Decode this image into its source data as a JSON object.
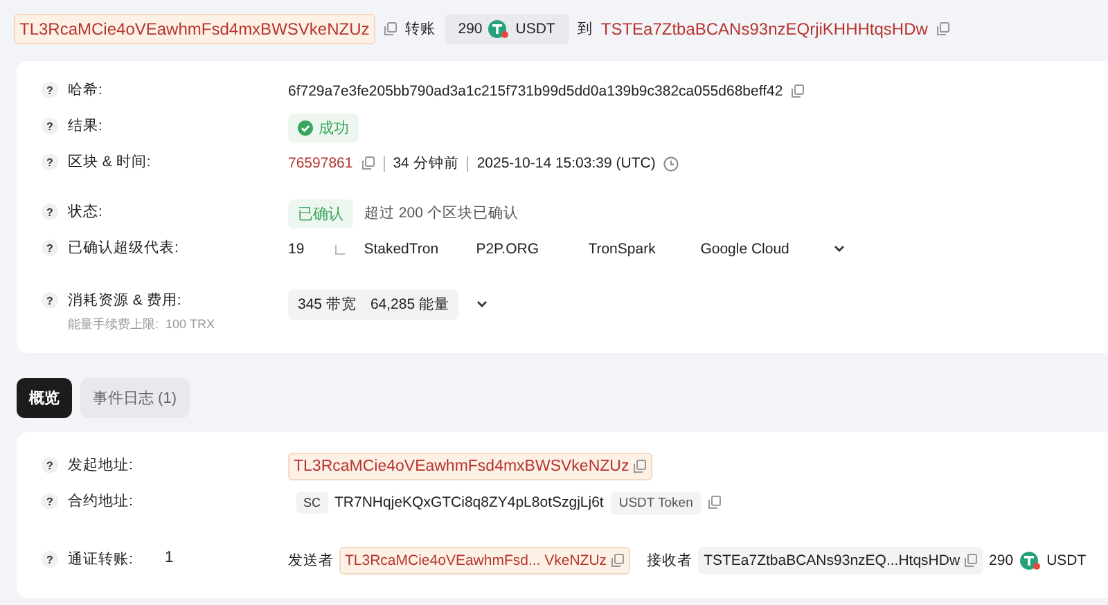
{
  "header": {
    "from": "TL3RcaMCie4oVEawhmFsd4mxBWSVkeNZUz",
    "action": "转账",
    "amount": "290",
    "token": "USDT",
    "to_word": "到",
    "to": "TSTEa7ZtbaBCANs93nzEQrjiKHHHtqsHDw"
  },
  "details": [
    {
      "kind": "hash",
      "help": "?",
      "label": "哈希:",
      "value": "6f729a7e3fe205bb790ad3a1c215f731b99d5dd0a139b9c382ca055d68beff42"
    },
    {
      "kind": "result",
      "help": "?",
      "label": "结果:",
      "badge": "成功"
    },
    {
      "kind": "block",
      "help": "?",
      "label": "区块 & 时间:",
      "block": "76597861",
      "ago": "34 分钟前",
      "time": "2025-10-14 15:03:39 (UTC)"
    },
    {
      "kind": "confirm",
      "help": "?",
      "label": "状态:",
      "badge": "已确认",
      "note": "超过 200 个区块已确认"
    },
    {
      "kind": "reps",
      "help": "?",
      "label": "已确认超级代表:",
      "count": "19",
      "reps": [
        "StakedTron",
        "P2P.ORG",
        "TronSpark",
        "Google Cloud"
      ]
    },
    {
      "kind": "resource",
      "help": "?",
      "label": "消耗资源 & 费用:",
      "sublabel": "能量手续费上限:",
      "sublabel_value": "100 TRX",
      "bandwidth": "345 带宽",
      "energy": "64,285 能量"
    }
  ],
  "tabs": [
    {
      "label": "概览",
      "selected": true
    },
    {
      "label": "事件日志",
      "count": "(1)",
      "selected": false
    }
  ],
  "overview": [
    {
      "kind": "address",
      "help": "?",
      "label": "发起地址:",
      "value": "TL3RcaMCie4oVEawhmFsd4mxBWSVkeNZUz"
    },
    {
      "kind": "contract",
      "help": "?",
      "label": "合约地址:",
      "badge": "SC",
      "value": "TR7NHqjeKQxGTCi8q8ZY4pL8otSzgjLj6t",
      "tag": "USDT Token"
    },
    {
      "kind": "transfer",
      "help": "?",
      "label": "通证转账:",
      "count": "1",
      "sender_label": "发送者",
      "sender": "TL3RcaMCie4oVEawhmFsd... VkeNZUz",
      "receiver_label": "接收者",
      "receiver": "TSTEa7ZtbaBCANs93nzEQ...HtqsHDw",
      "amount": "290",
      "token": "USDT"
    }
  ]
}
